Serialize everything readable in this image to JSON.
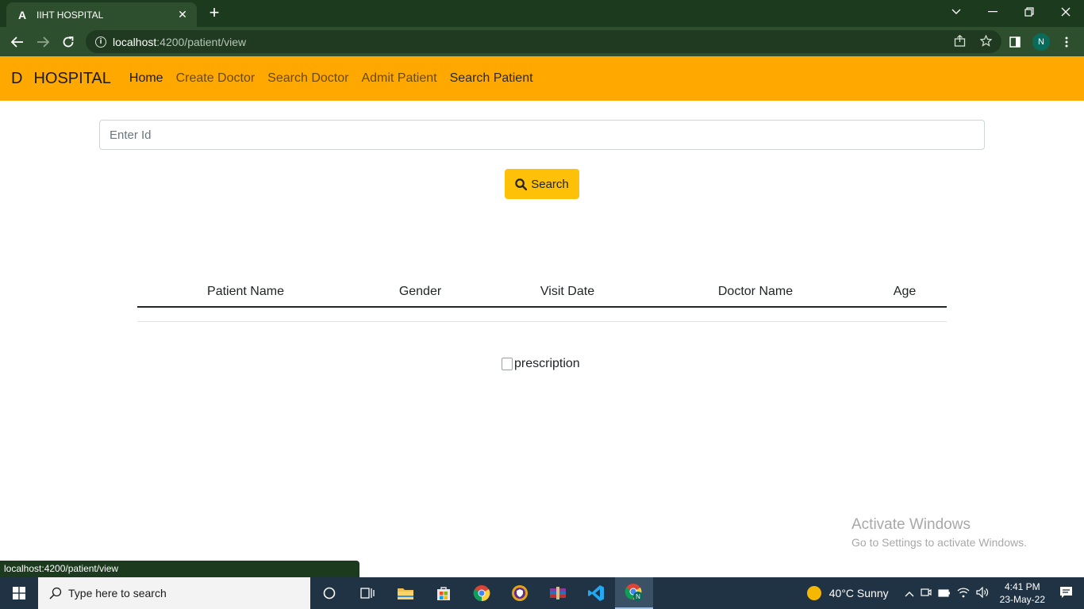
{
  "browser": {
    "tab_title": "IIHT HOSPITAL",
    "tab_logo": "A",
    "url_host": "localhost",
    "url_path": ":4200/patient/view",
    "profile_initial": "N"
  },
  "navbar": {
    "brand_letter": "D",
    "brand": "HOSPITAL",
    "links": [
      {
        "label": "Home"
      },
      {
        "label": "Create Doctor"
      },
      {
        "label": "Search Doctor"
      },
      {
        "label": "Admit Patient"
      },
      {
        "label": "Search Patient"
      }
    ]
  },
  "search": {
    "placeholder": "Enter Id",
    "button_label": "Search"
  },
  "table": {
    "columns": [
      "Patient Name",
      "Gender",
      "Visit Date",
      "Doctor Name",
      "Age"
    ]
  },
  "image_alt": "prescription",
  "watermark": {
    "line1": "Activate Windows",
    "line2": "Go to Settings to activate Windows."
  },
  "status_url": "localhost:4200/patient/view",
  "taskbar": {
    "search_placeholder": "Type here to search",
    "weather": "40°C  Sunny",
    "time": "4:41 PM",
    "date": "23-May-22"
  },
  "colors": {
    "navbar": "#ffa800",
    "search_button": "#ffc107",
    "browser_frame": "#1c3a1e"
  }
}
